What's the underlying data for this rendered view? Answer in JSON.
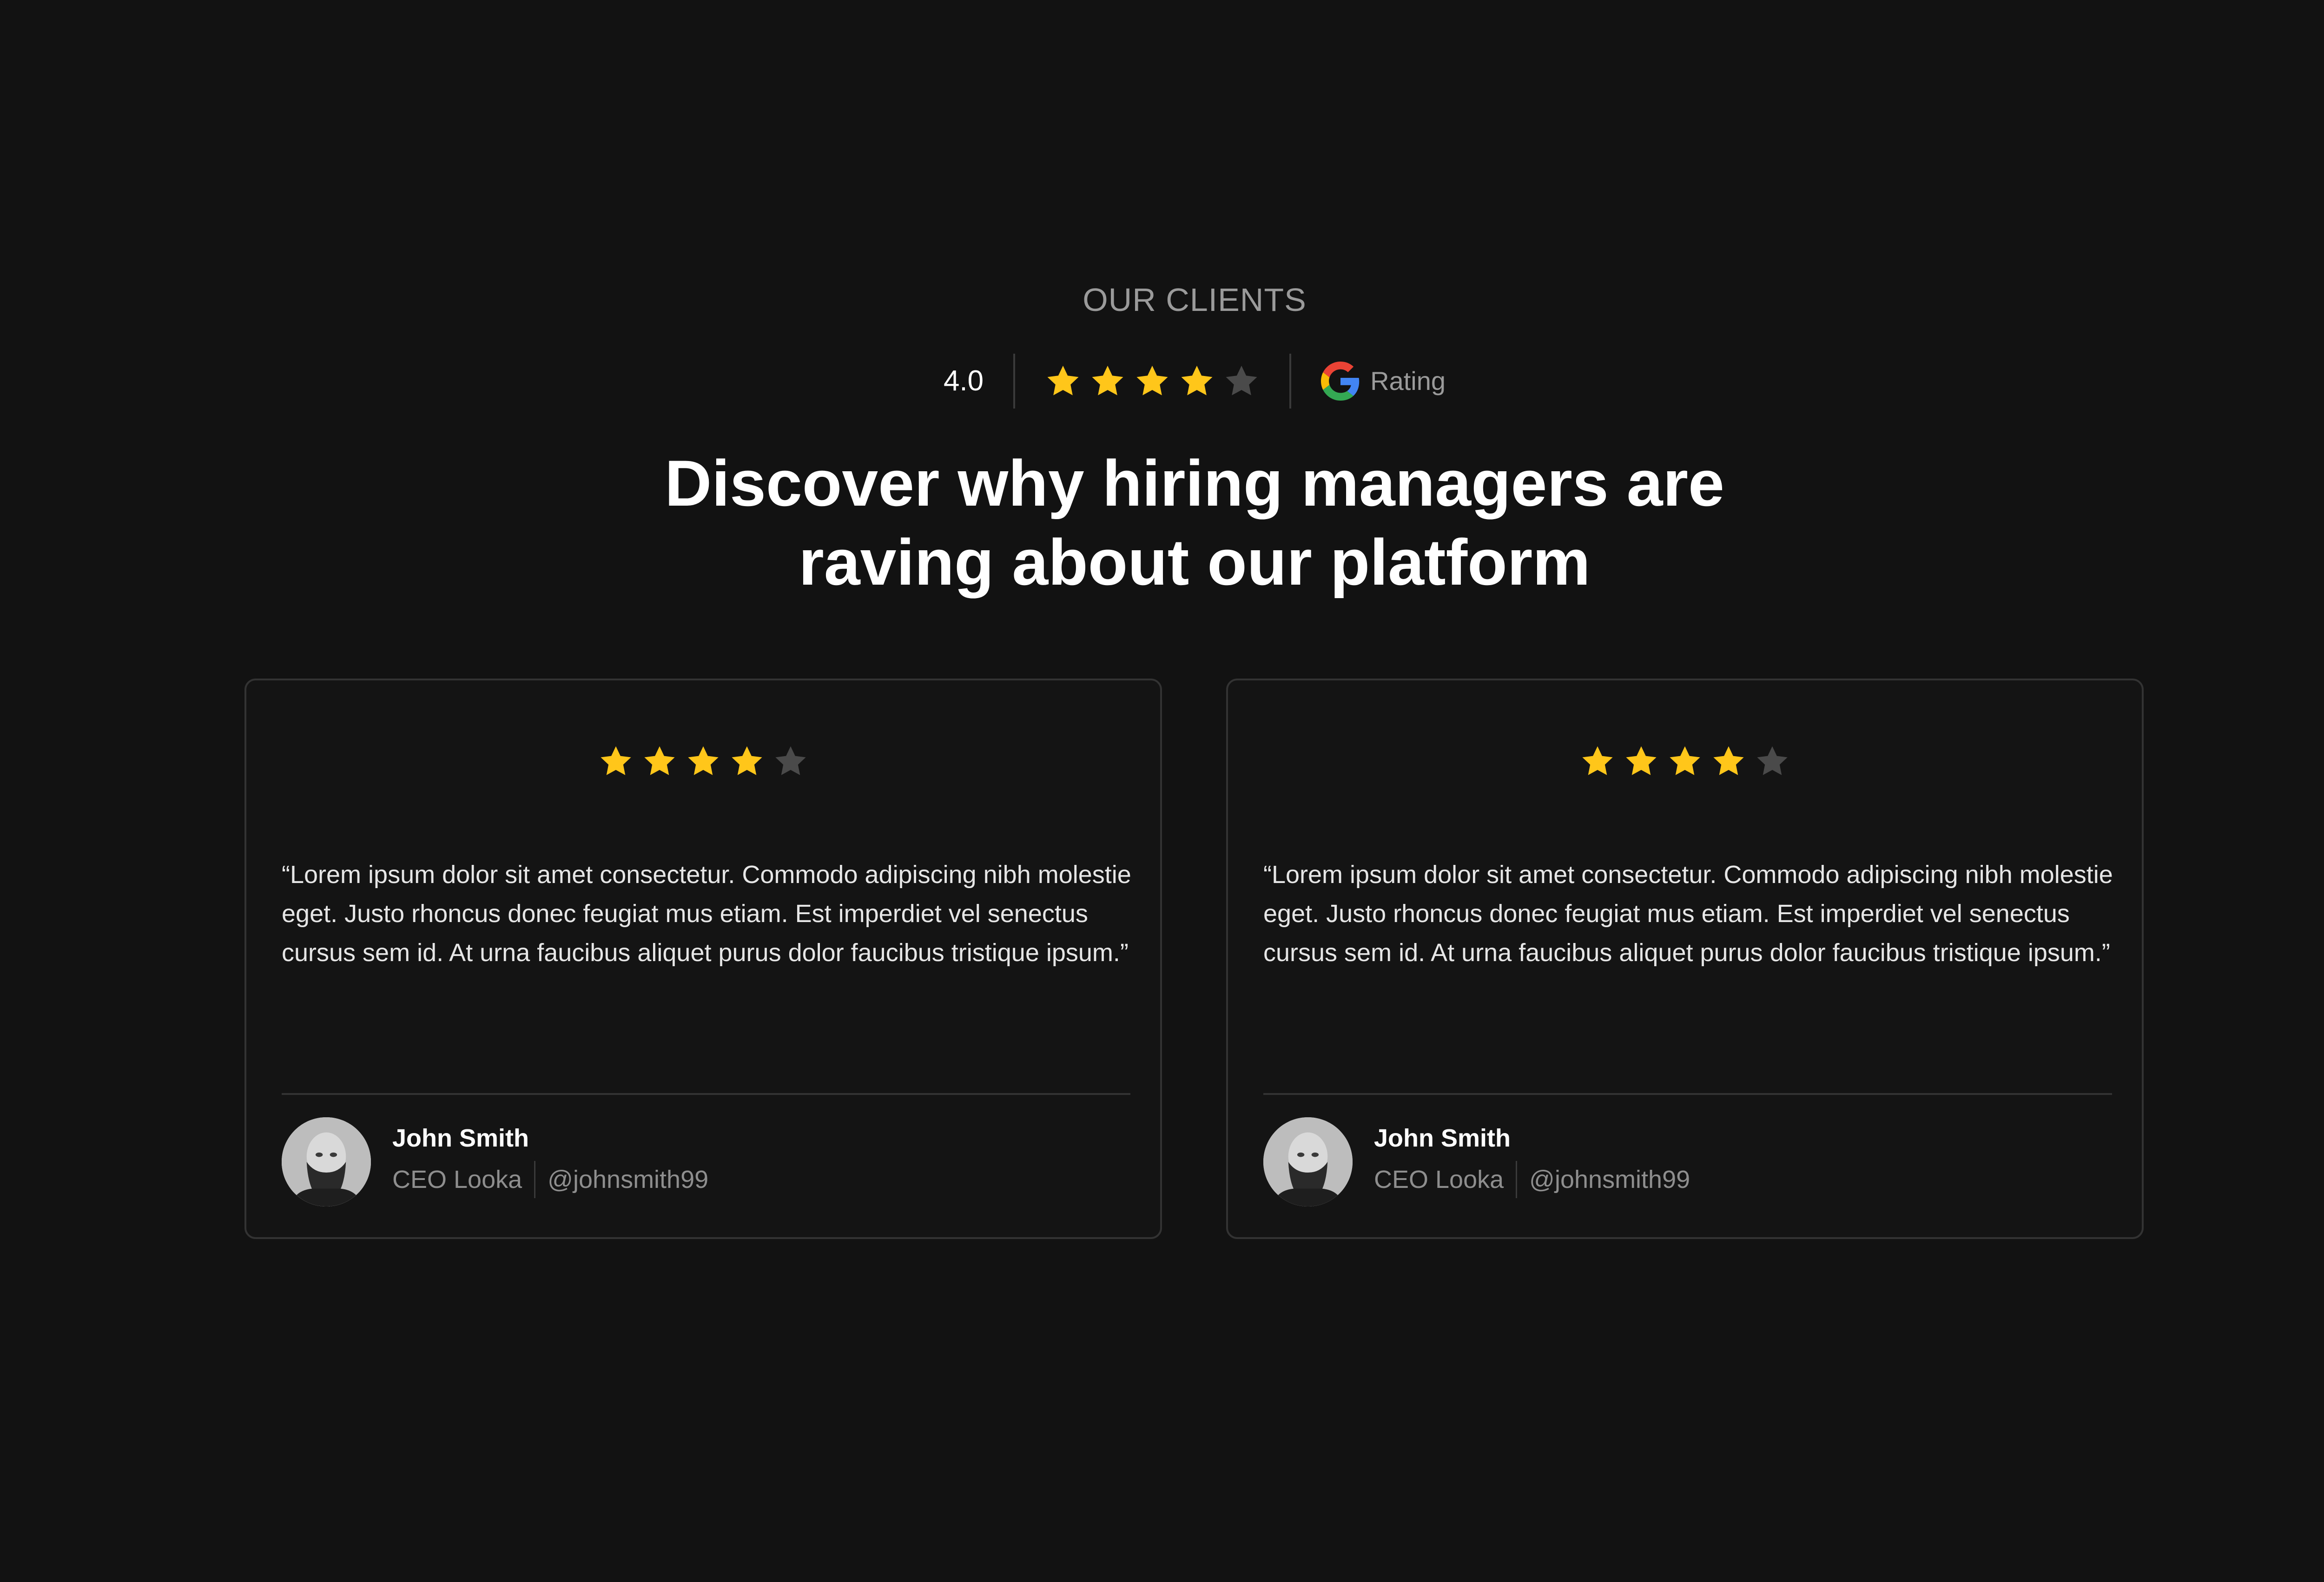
{
  "section": {
    "eyebrow": "OUR CLIENTS",
    "rating": {
      "value": "4.0",
      "stars_filled": 4,
      "stars_total": 5,
      "provider_icon": "google-icon",
      "label": "Rating"
    },
    "headline_line1": "Discover why hiring managers are",
    "headline_line2": "raving about our platform"
  },
  "colors": {
    "background": "#121212",
    "star_filled": "#FFC61A",
    "star_empty": "#4A4A4A",
    "card_border": "#333333",
    "muted_text": "#9A9A9A"
  },
  "testimonials": [
    {
      "stars_filled": 4,
      "stars_total": 5,
      "quote": "“Lorem ipsum dolor sit amet consectetur. Commodo adipiscing nibh molestie eget. Justo rhoncus donec feugiat mus etiam. Est imperdiet vel senectus cursus sem id. At urna faucibus aliquet purus dolor faucibus tristique ipsum.”",
      "author": {
        "name": "John Smith",
        "role": "CEO Looka",
        "handle": "@johnsmith99",
        "avatar_icon": "avatar-photo"
      }
    },
    {
      "stars_filled": 4,
      "stars_total": 5,
      "quote": "“Lorem ipsum dolor sit amet consectetur. Commodo adipiscing nibh molestie eget. Justo rhoncus donec feugiat mus etiam. Est imperdiet vel senectus cursus sem id. At urna faucibus aliquet purus dolor faucibus tristique ipsum.”",
      "author": {
        "name": "John Smith",
        "role": "CEO Looka",
        "handle": "@johnsmith99",
        "avatar_icon": "avatar-photo"
      }
    }
  ]
}
